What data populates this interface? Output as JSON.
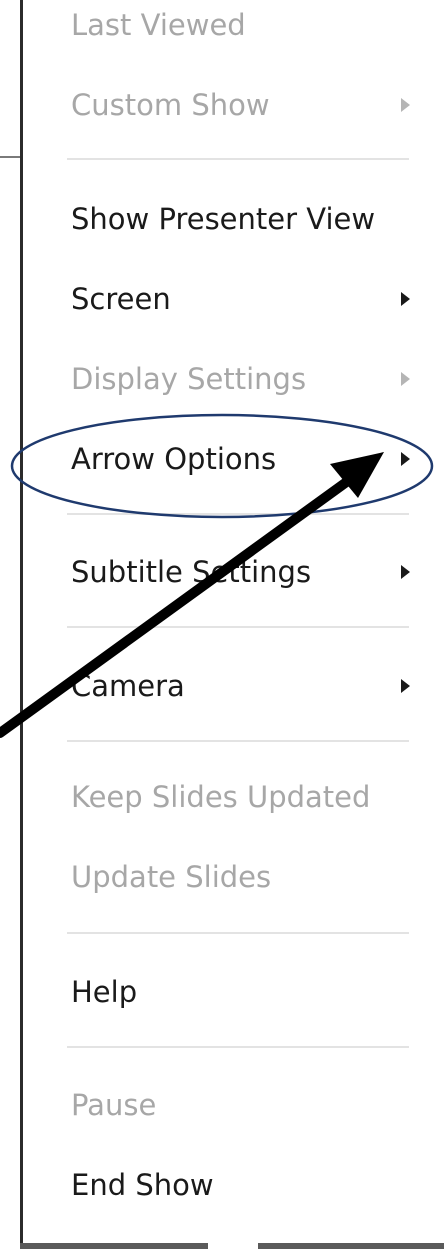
{
  "menu": {
    "items": [
      {
        "label": "Last Viewed",
        "enabled": false,
        "submenu": false
      },
      {
        "label": "Custom Show",
        "enabled": false,
        "submenu": true
      },
      {
        "label": "Show Presenter View",
        "enabled": true,
        "submenu": false
      },
      {
        "label": "Screen",
        "enabled": true,
        "submenu": true
      },
      {
        "label": "Display Settings",
        "enabled": false,
        "submenu": true
      },
      {
        "label": "Arrow Options",
        "enabled": true,
        "submenu": true,
        "highlighted_by_annotation": true
      },
      {
        "label": "Subtitle Settings",
        "enabled": true,
        "submenu": true
      },
      {
        "label": "Camera",
        "enabled": true,
        "submenu": true
      },
      {
        "label": "Keep Slides Updated",
        "enabled": false,
        "submenu": false
      },
      {
        "label": "Update Slides",
        "enabled": false,
        "submenu": false
      },
      {
        "label": "Help",
        "enabled": true,
        "submenu": false
      },
      {
        "label": "Pause",
        "enabled": false,
        "submenu": false
      },
      {
        "label": "End Show",
        "enabled": true,
        "submenu": false
      }
    ]
  },
  "colors": {
    "enabled_text": "#1a1a1a",
    "disabled_text": "#a7a7a7",
    "separator": "#e3e3e3",
    "annotation_ellipse": "#1f3a6e",
    "annotation_arrow": "#000000"
  },
  "icons": {
    "submenu": "chevron-right-icon"
  }
}
